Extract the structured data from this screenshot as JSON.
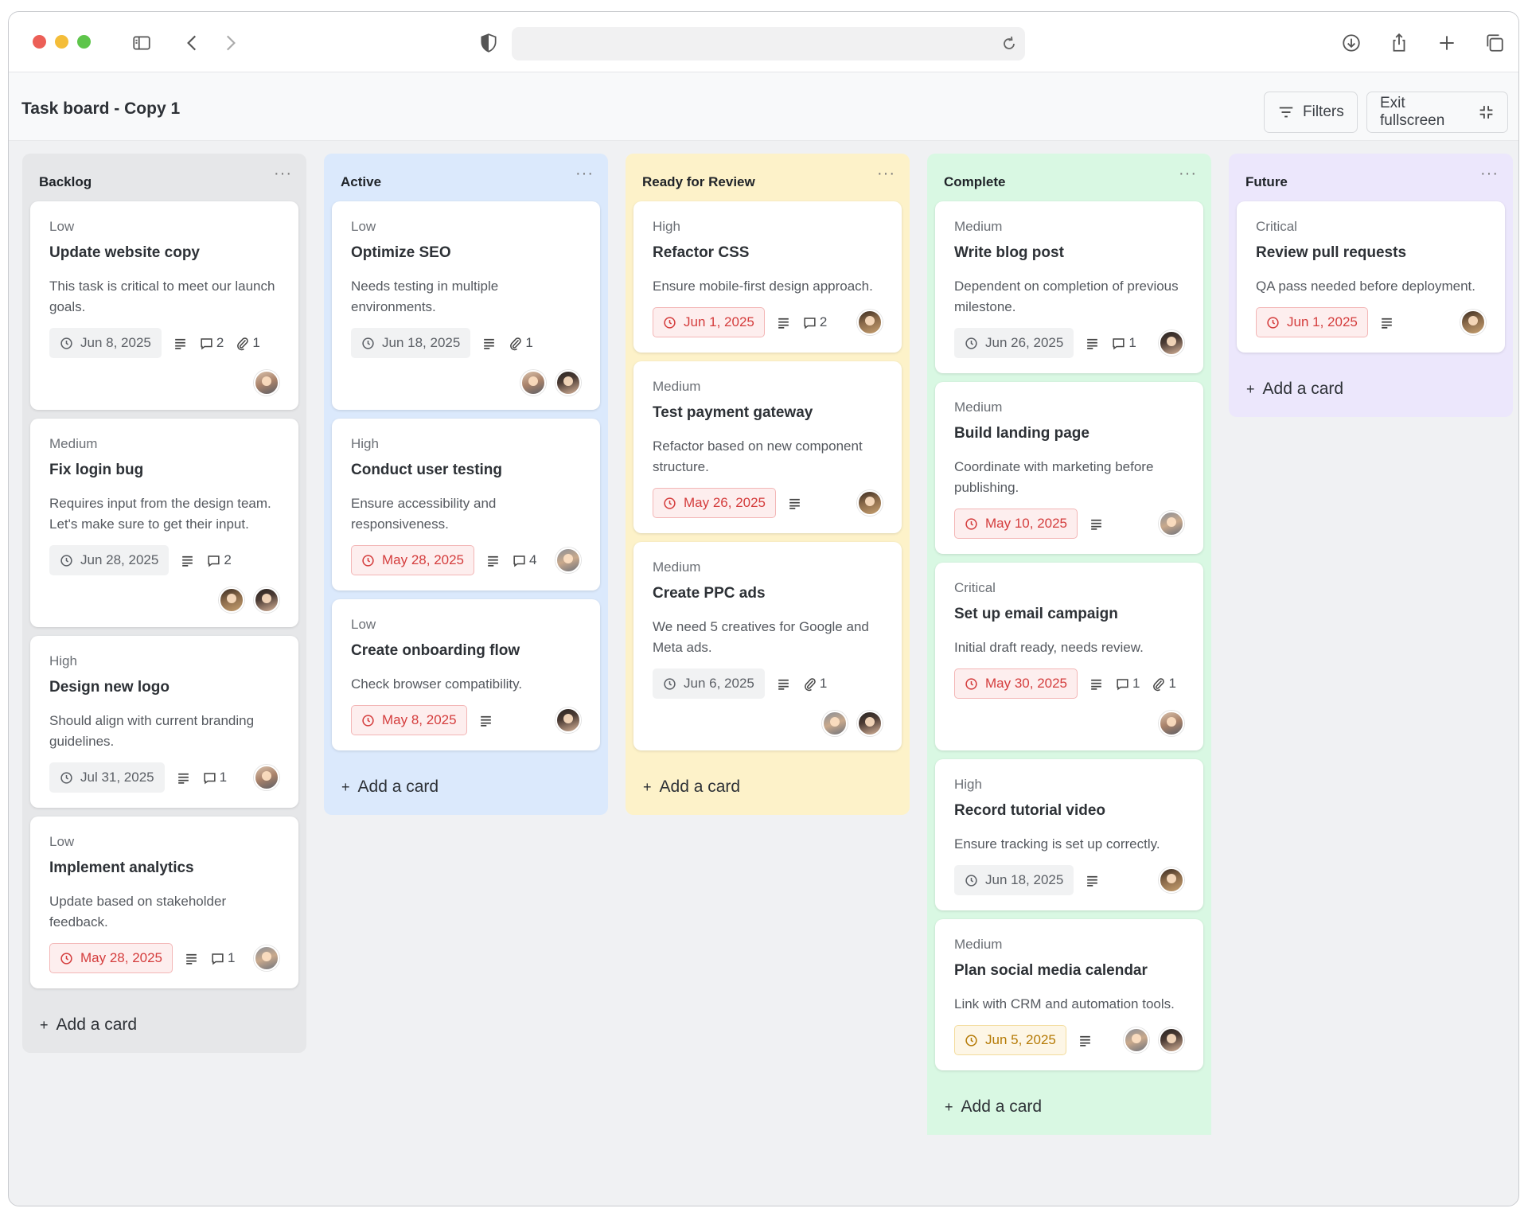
{
  "browser": {
    "url": ""
  },
  "header": {
    "title": "Task board - Copy 1",
    "filters_label": "Filters",
    "exit_label": "Exit fullscreen"
  },
  "colors": {
    "backlog": "#e6e7e9",
    "active": "#dbe9fc",
    "review": "#fdf2c9",
    "complete": "#d9f8e3",
    "future": "#ece7fc",
    "overdue": "#d43c3c",
    "soon": "#b57a05"
  },
  "columns": [
    {
      "title": "Backlog",
      "more": "···",
      "add_label": "Add a card",
      "cards": [
        {
          "priority": "Low",
          "title": "Update website copy",
          "desc": "This task is critical to meet our launch goals.",
          "date": "Jun 8, 2025",
          "date_state": "normal",
          "comments": "2",
          "attachments": "1",
          "avatars": [
            "avatar-bald-man"
          ]
        },
        {
          "priority": "Medium",
          "title": "Fix login bug",
          "desc": "Requires input from the design team. Let's make sure to get their input.",
          "date": "Jun 28, 2025",
          "date_state": "normal",
          "comments": "2",
          "attachments": "",
          "avatars": [
            "avatar-curly-hair",
            "avatar-dark-hair-man"
          ]
        },
        {
          "priority": "High",
          "title": "Design new logo",
          "desc": "Should align with current branding guidelines.",
          "date": "Jul 31, 2025",
          "date_state": "normal",
          "comments": "1",
          "attachments": "",
          "avatars": [
            "avatar-bald-man"
          ]
        },
        {
          "priority": "Low",
          "title": "Implement analytics",
          "desc": "Update based on stakeholder feedback.",
          "date": "May 28, 2025",
          "date_state": "overdue",
          "comments": "1",
          "attachments": "",
          "avatars": [
            "avatar-woman"
          ]
        }
      ]
    },
    {
      "title": "Active",
      "more": "···",
      "add_label": "Add a card",
      "cards": [
        {
          "priority": "Low",
          "title": "Optimize SEO",
          "desc": "Needs testing in multiple environments.",
          "date": "Jun 18, 2025",
          "date_state": "normal",
          "comments": "",
          "attachments": "1",
          "avatars": [
            "avatar-bald-man",
            "avatar-dark-hair-man"
          ]
        },
        {
          "priority": "High",
          "title": "Conduct user testing",
          "desc": "Ensure accessibility and responsiveness.",
          "date": "May 28, 2025",
          "date_state": "overdue",
          "comments": "4",
          "attachments": "",
          "avatars": [
            "avatar-woman"
          ]
        },
        {
          "priority": "Low",
          "title": "Create onboarding flow",
          "desc": "Check browser compatibility.",
          "date": "May 8, 2025",
          "date_state": "overdue",
          "comments": "",
          "attachments": "",
          "avatars": [
            "avatar-dark-hair-man"
          ]
        }
      ]
    },
    {
      "title": "Ready for Review",
      "more": "···",
      "add_label": "Add a card",
      "cards": [
        {
          "priority": "High",
          "title": "Refactor CSS",
          "desc": "Ensure mobile-first design approach.",
          "date": "Jun 1, 2025",
          "date_state": "overdue",
          "comments": "2",
          "attachments": "",
          "avatars": [
            "avatar-curly-hair"
          ]
        },
        {
          "priority": "Medium",
          "title": "Test payment gateway",
          "desc": "Refactor based on new component structure.",
          "date": "May 26, 2025",
          "date_state": "overdue",
          "comments": "",
          "attachments": "",
          "avatars": [
            "avatar-curly-hair"
          ]
        },
        {
          "priority": "Medium",
          "title": "Create PPC ads",
          "desc": "We need 5 creatives for Google and Meta ads.",
          "date": "Jun 6, 2025",
          "date_state": "normal",
          "comments": "",
          "attachments": "1",
          "avatars": [
            "avatar-woman",
            "avatar-dark-hair-man"
          ]
        }
      ]
    },
    {
      "title": "Complete",
      "more": "···",
      "add_label": "Add a card",
      "cards": [
        {
          "priority": "Medium",
          "title": "Write blog post",
          "desc": "Dependent on completion of previous milestone.",
          "date": "Jun 26, 2025",
          "date_state": "normal",
          "comments": "1",
          "attachments": "",
          "avatars": [
            "avatar-dark-hair-man"
          ]
        },
        {
          "priority": "Medium",
          "title": "Build landing page",
          "desc": "Coordinate with marketing before publishing.",
          "date": "May 10, 2025",
          "date_state": "overdue",
          "comments": "",
          "attachments": "",
          "avatars": [
            "avatar-woman"
          ]
        },
        {
          "priority": "Critical",
          "title": "Set up email campaign",
          "desc": "Initial draft ready, needs review.",
          "date": "May 30, 2025",
          "date_state": "overdue",
          "comments": "1",
          "attachments": "1",
          "avatars": [
            "avatar-bald-man"
          ]
        },
        {
          "priority": "High",
          "title": "Record tutorial video",
          "desc": "Ensure tracking is set up correctly.",
          "date": "Jun 18, 2025",
          "date_state": "normal",
          "comments": "",
          "attachments": "",
          "avatars": [
            "avatar-curly-hair"
          ]
        },
        {
          "priority": "Medium",
          "title": "Plan social media calendar",
          "desc": "Link with CRM and automation tools.",
          "date": "Jun 5, 2025",
          "date_state": "soon",
          "comments": "",
          "attachments": "",
          "avatars": [
            "avatar-woman",
            "avatar-dark-hair-man"
          ]
        }
      ]
    },
    {
      "title": "Future",
      "more": "···",
      "add_label": "Add a card",
      "cards": [
        {
          "priority": "Critical",
          "title": "Review pull requests",
          "desc": "QA pass needed before deployment.",
          "date": "Jun 1, 2025",
          "date_state": "overdue",
          "comments": "",
          "attachments": "",
          "avatars": [
            "avatar-curly-hair"
          ]
        }
      ]
    }
  ]
}
